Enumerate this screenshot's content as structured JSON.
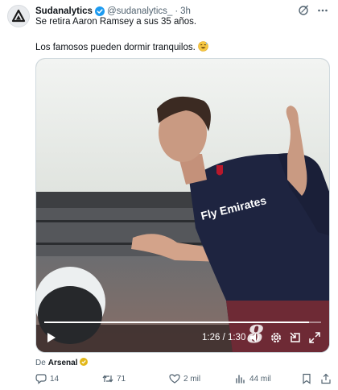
{
  "tweet": {
    "author": "Sudanalytics",
    "handle": "@sudanalytics_",
    "separator": "·",
    "time": "3h",
    "line1": "Se retira Aaron Ramsey a sus 35 años.",
    "line2": "Los famosos pueden dormir tranquilos."
  },
  "video": {
    "time_display": "1:26 / 1:30",
    "progress": 0.955,
    "watermark_digit": "8",
    "shirt_text": "Fly Emirates"
  },
  "source": {
    "prefix": "De",
    "name": "Arsenal"
  },
  "actions": {
    "replies": "14",
    "reposts": "71",
    "likes": "2 mil",
    "views": "44 mil"
  },
  "colors": {
    "verified": "#1d9bf0",
    "secondary_text": "#536471",
    "gold_badge": "#e2b719"
  }
}
